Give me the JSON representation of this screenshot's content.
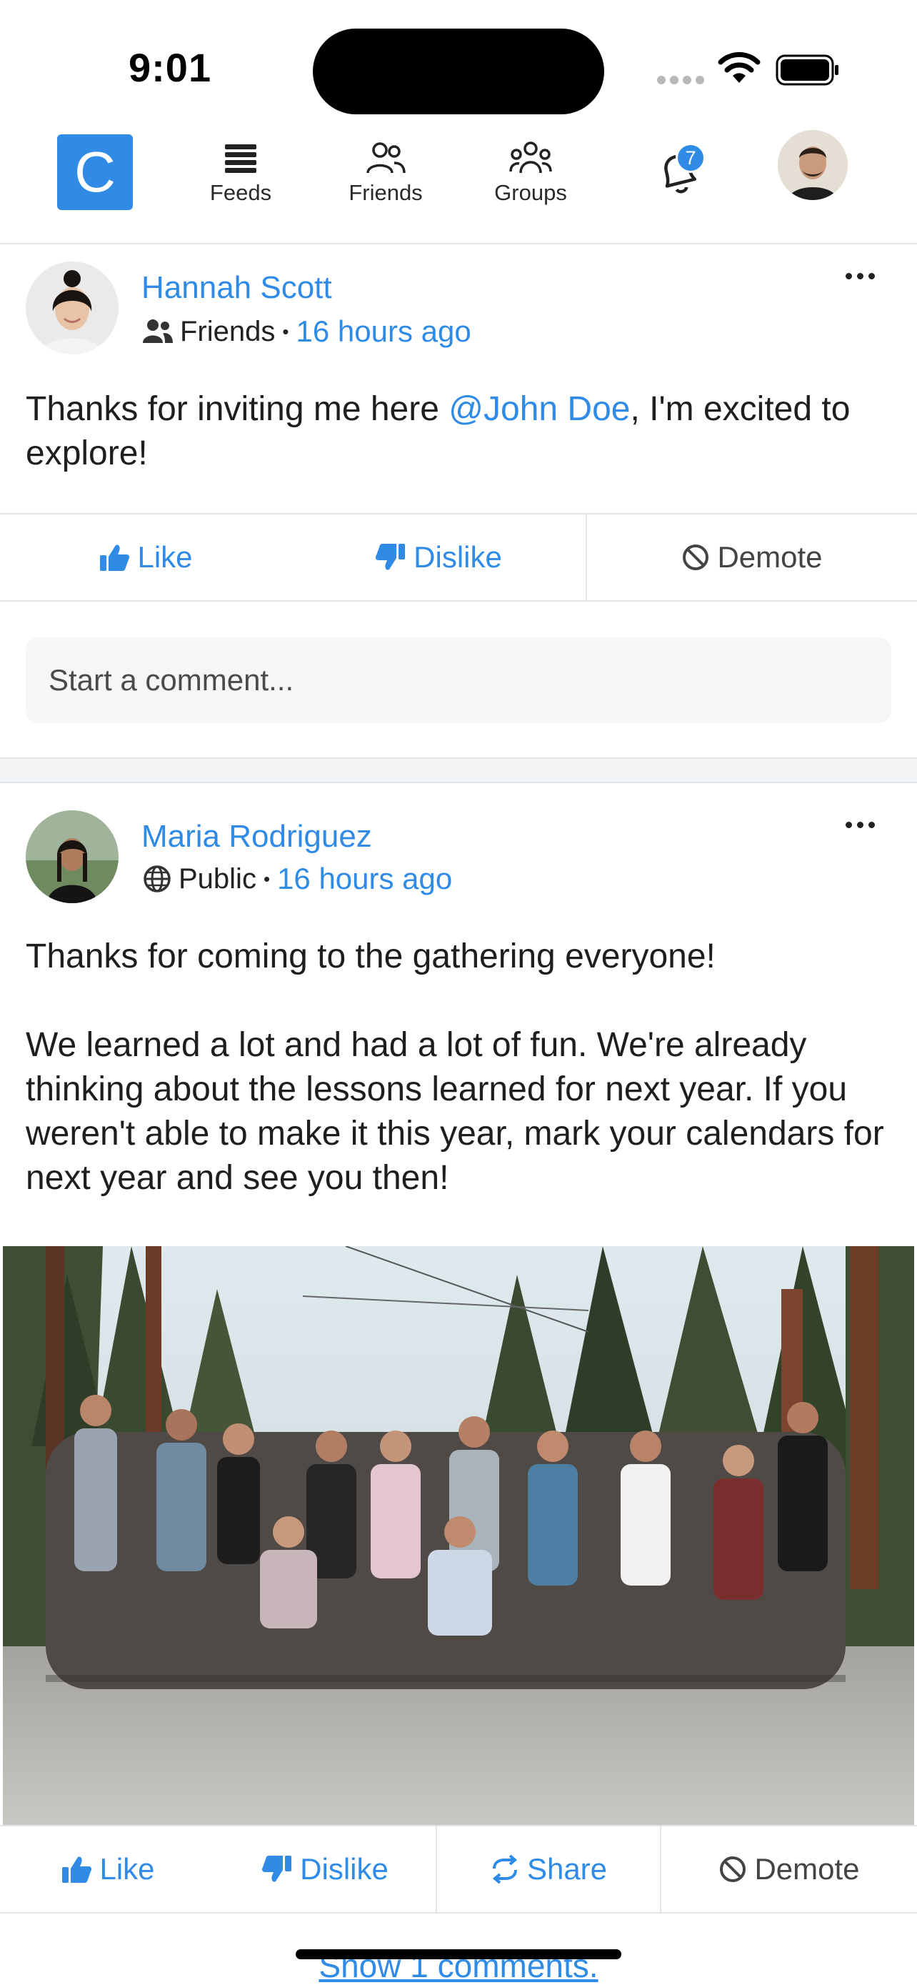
{
  "status_bar": {
    "time": "9:01"
  },
  "nav": {
    "logo_letter": "C",
    "items": [
      {
        "label": "Feeds",
        "icon": "feeds-icon"
      },
      {
        "label": "Friends",
        "icon": "friends-icon"
      },
      {
        "label": "Groups",
        "icon": "groups-icon"
      }
    ],
    "notification_count": "7"
  },
  "posts": [
    {
      "author": "Hannah Scott",
      "audience": "Friends",
      "audience_icon": "friends-icon",
      "time": "16 hours ago",
      "text_before": "Thanks for inviting me here ",
      "mention": "@John Doe",
      "text_after": ", I'm excited to explore!",
      "actions": {
        "like": "Like",
        "dislike": "Dislike",
        "demote": "Demote"
      },
      "comment_placeholder": "Start a comment..."
    },
    {
      "author": "Maria Rodriguez",
      "audience": "Public",
      "audience_icon": "globe-icon",
      "time": "16 hours ago",
      "paragraph1": "Thanks for coming to the gathering everyone!",
      "paragraph2": "We learned a lot and had a lot of fun. We're already thinking about the lessons learned for next year. If you weren't able to make it this year, mark your calendars for next year and see you then!",
      "actions": {
        "like": "Like",
        "dislike": "Dislike",
        "share": "Share",
        "demote": "Demote"
      },
      "show_comments": "Show 1 comments."
    }
  ],
  "colors": {
    "accent": "#2f8be6",
    "divider": "#e1e4e8"
  }
}
